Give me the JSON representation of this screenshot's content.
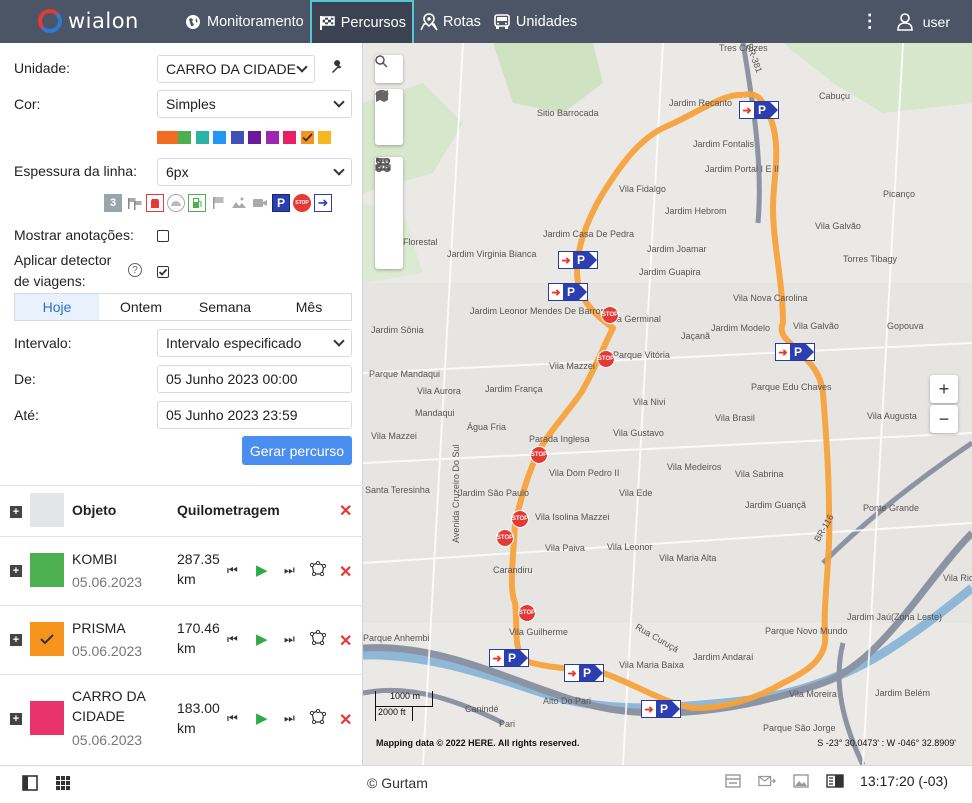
{
  "app": {
    "logo_text": "wialon"
  },
  "nav": [
    {
      "label": "Monitoramento",
      "icon": "globe-icon"
    },
    {
      "label": "Percursos",
      "icon": "checkered-flag-icon"
    },
    {
      "label": "Rotas",
      "icon": "route-pin-icon"
    },
    {
      "label": "Unidades",
      "icon": "bus-icon"
    }
  ],
  "user": {
    "name": "user"
  },
  "form": {
    "unit_label": "Unidade:",
    "unit_value": "CARRO DA CIDADE",
    "color_label": "Cor:",
    "color_value": "Simples",
    "swatches": [
      "#f26d21",
      "#4caf50",
      "#2bb3a6",
      "#2196f3",
      "#3f51b5",
      "#6a1b9a",
      "#9c27b0",
      "#e91e63",
      "#f7941d",
      "#f5b820"
    ],
    "line_label": "Espessura da linha:",
    "line_value": "6px",
    "annotations_label": "Mostrar anotações:",
    "detector_label_1": "Aplicar detector",
    "detector_label_2": "de viagens:",
    "interval_label": "Intervalo:",
    "interval_value": "Intervalo especificado",
    "from_label": "De:",
    "from_value": "05 Junho 2023 00:00",
    "to_label": "Até:",
    "to_value": "05 Junho 2023 23:59",
    "generate_button": "Gerar percurso"
  },
  "tabs": [
    "Hoje",
    "Ontem",
    "Semana",
    "Mês"
  ],
  "tracks_header": {
    "object": "Objeto",
    "mileage": "Quilometragem"
  },
  "tracks": [
    {
      "name": "KOMBI",
      "date": "05.06.2023",
      "km1": "287.35",
      "km2": "km",
      "color": "#4caf50"
    },
    {
      "name": "PRISMA",
      "date": "05.06.2023",
      "km1": "170.46",
      "km2": "km",
      "color": "#f7941d"
    },
    {
      "name1": "CARRO DA",
      "name2": "CIDADE",
      "date": "05.06.2023",
      "km1": "183.00",
      "km2": "km",
      "color": "#e8336d"
    }
  ],
  "map": {
    "labels": {
      "tres_cruzes": "Tres Cruzes",
      "jardim_recanto": "Jardim Recanto",
      "cabucu": "Cabuçu",
      "sitio_barrocada": "Sitio Barrocada",
      "jardim_fontalis": "Jardim Fontalis",
      "jardim_portal": "Jardim Portal I E II",
      "vila_fidalgo": "Vila Fidalgo",
      "picanco": "Picanço",
      "jardim_hebrom": "Jardim Hebrom",
      "vila_galvao": "Vila Galvão",
      "jardim_casa_pedra": "Jardim Casa De Pedra",
      "florestal": "Florestal",
      "jardim_joamar": "Jardim Joamar",
      "jardim_virginia": "Jardim Virginia Bianca",
      "torres_tibagy": "Torres Tibagy",
      "jardim_guapira": "Jardim Guapira",
      "vila_nova_carolina": "Vila Nova Carolina",
      "jardim_leonor": "Jardim Leonor Mendes De Barros",
      "vila_germinal": "Vila Germinal",
      "jardim_sonia": "Jardim Sônia",
      "jacana": "Jaçanã",
      "jardim_modelo": "Jardim Modelo",
      "vila_galvao2": "Vila Galvão",
      "gopouva": "Gopouva",
      "parque_vitoria": "Parque Vitória",
      "parque_mandaqui": "Parque Mandaqui",
      "vila_mazzei": "Vila Mazzei",
      "parque_edu_chaves": "Parque Edu Chaves",
      "vila_aurora": "Vila Aurora",
      "jardim_franca": "Jardim França",
      "vila_nivi": "Vila Nivi",
      "vila_brasil": "Vila Brasil",
      "vila_augusta": "Vila Augusta",
      "mandaqui": "Mandaqui",
      "agua_fria": "Água Fria",
      "vila_gustavo": "Vila Gustavo",
      "vila_mazzei2": "Vila Mazzei",
      "parada_inglesa": "Parada Inglesa",
      "vila_medeiros": "Vila Medeiros",
      "vila_dom_pedro": "Vila Dom Pedro II",
      "vila_sabrina": "Vila Sabrina",
      "santa_teresinha": "Santa Teresinha",
      "jardim_sao_paulo": "Jardim São Paulo",
      "vila_ede": "Vila Ede",
      "jardim_guanca": "Jardim Guançã",
      "ponte_grande": "Ponte Grande",
      "vila_isolina": "Vila Isolina Mazzei",
      "vila_paiva": "Vila Paiva",
      "vila_leonor": "Vila Leonor",
      "vila_maria_alta": "Vila Maria Alta",
      "vila_rio": "Vila Rio",
      "carandiru": "Carandiru",
      "jardim_jau": "Jardim Jaú(Zona Leste)",
      "vila_guilherme": "Vila Guilherme",
      "parque_anhembi": "Parque Anhembi",
      "parque_novo_mundo": "Parque Novo Mundo",
      "vila_maria_baixa": "Vila Maria Baixa",
      "jardim_andarai": "Jardim Andaraí",
      "vila_moreira": "Vila Moreira",
      "jardim_belem": "Jardim Belém",
      "alto_do_pari": "Alto Do Pari",
      "caninde": "Canindé",
      "pari": "Pari",
      "parque_sao_jorge": "Parque São Jorge",
      "av_cruzeiro": "Avenida Cruzeiro Do Sul",
      "rua_curuca": "Rua Curuçá",
      "bra": "BR-381",
      "bra2": "BR-116"
    },
    "scale_top": "1000 m",
    "scale_bottom": "2000 ft",
    "copyright": "Mapping data © 2022 HERE. All rights reserved.",
    "coords": "S -23° 30.0473' : W -046° 32.8909'"
  },
  "footer": {
    "copyright": "© Gurtam",
    "time": "13:17:20 (-03)"
  }
}
